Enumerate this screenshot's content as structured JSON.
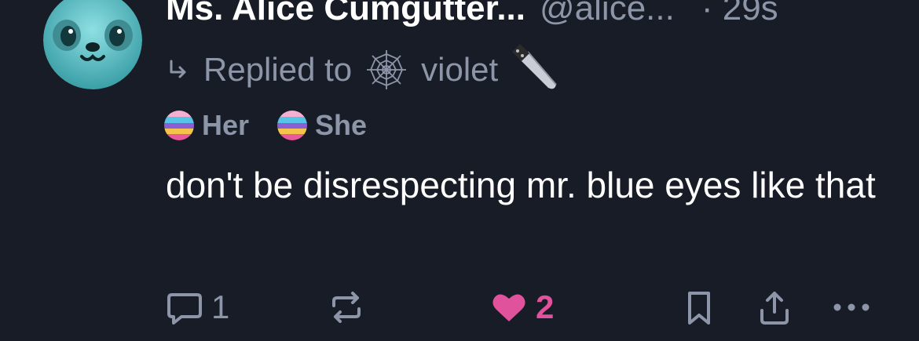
{
  "post": {
    "display_name": "Ms. Alice Cumgutter...",
    "handle": "@alice...",
    "time": "· 29s",
    "reply_prefix": "Replied to",
    "reply_to_name": "violet",
    "pronouns": [
      "Her",
      "She"
    ],
    "text": "don't be disrespecting mr. blue eyes like that"
  },
  "actions": {
    "reply_count": "1",
    "like_count": "2"
  },
  "icons": {
    "avatar": "seal-avatar-icon",
    "reply_arrow": "reply-arrow-icon",
    "reply_to_avatar": "spider-web-icon",
    "emoji": "kitchen-knife-icon",
    "pronoun_badge": "pronoun-badge-icon",
    "comment": "comment-icon",
    "repost": "repost-icon",
    "like": "heart-icon",
    "bookmark": "bookmark-icon",
    "share": "share-icon",
    "more": "more-icon"
  },
  "colors": {
    "background": "#181c26",
    "text_primary": "#ffffff",
    "text_secondary": "#8c96a8",
    "like": "#e0529c",
    "avatar": "#56b9bf"
  }
}
